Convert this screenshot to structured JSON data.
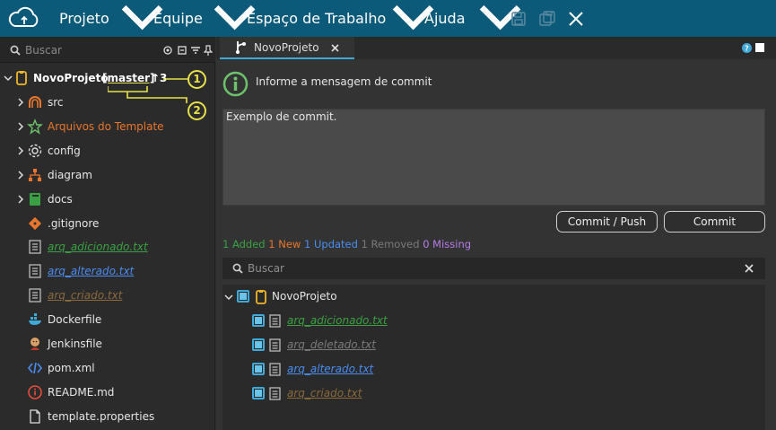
{
  "menu": {
    "items": [
      {
        "label": "Projeto"
      },
      {
        "label": "Equipe"
      },
      {
        "label": "Espaço de Trabalho"
      },
      {
        "label": "Ajuda"
      }
    ]
  },
  "left": {
    "search_placeholder": "Buscar",
    "project": {
      "name": "NovoProjeto",
      "branch": "[master]",
      "ahead": "↑3"
    },
    "callouts": [
      "1",
      "2"
    ],
    "tree": [
      {
        "label": "src",
        "color": "#e6e6e6",
        "icon": "source-folder-icon"
      },
      {
        "label": "Arquivos do Template",
        "color": "#e8762d",
        "icon": "star-icon"
      },
      {
        "label": "config",
        "color": "#e6e6e6",
        "icon": "gear-icon"
      },
      {
        "label": "diagram",
        "color": "#e6e6e6",
        "icon": "diagram-icon"
      },
      {
        "label": "docs",
        "color": "#e6e6e6",
        "icon": "book-icon"
      },
      {
        "label": ".gitignore",
        "color": "#e6e6e6",
        "icon": "git-icon"
      },
      {
        "label": "arq_adicionado.txt",
        "color": "#3aa043",
        "icon": "text-file-icon"
      },
      {
        "label": "arq_alterado.txt",
        "color": "#4a8cf0",
        "icon": "text-file-icon"
      },
      {
        "label": "arq_criado.txt",
        "color": "#8a6a3c",
        "icon": "text-file-icon"
      },
      {
        "label": "Dockerfile",
        "color": "#e6e6e6",
        "icon": "docker-icon"
      },
      {
        "label": "Jenkinsfile",
        "color": "#e6e6e6",
        "icon": "jenkins-icon"
      },
      {
        "label": "pom.xml",
        "color": "#e6e6e6",
        "icon": "code-icon"
      },
      {
        "label": "README.md",
        "color": "#e6e6e6",
        "icon": "info-icon"
      },
      {
        "label": "template.properties",
        "color": "#e6e6e6",
        "icon": "file-icon"
      }
    ]
  },
  "right": {
    "tab_label": "NovoProjeto",
    "info_message": "Informe a mensagem de commit",
    "commit_message": "Exemplo de commit.",
    "buttons": {
      "commit_push": "Commit / Push",
      "commit": "Commit"
    },
    "status": {
      "added": "1 Added",
      "new": "1 New",
      "updated": "1 Updated",
      "removed": "1 Removed",
      "missing": "0 Missing"
    },
    "search_placeholder": "Buscar",
    "changes_root": "NovoProjeto",
    "changes": [
      {
        "label": "arq_adicionado.txt",
        "color": "#3aa043"
      },
      {
        "label": "arq_deletado.txt",
        "color": "#7a7a7a"
      },
      {
        "label": "arq_alterado.txt",
        "color": "#4a8cf0"
      },
      {
        "label": "arq_criado.txt",
        "color": "#8a6a3c"
      }
    ]
  },
  "colors": {
    "topbar": "#0b5a7a",
    "accent": "#3fa9d8",
    "callout": "#e6e14a",
    "added": "#3aa043",
    "new": "#e8762d",
    "updated": "#4a8cf0",
    "removed": "#7a7a7a",
    "missing": "#b77ce8"
  }
}
